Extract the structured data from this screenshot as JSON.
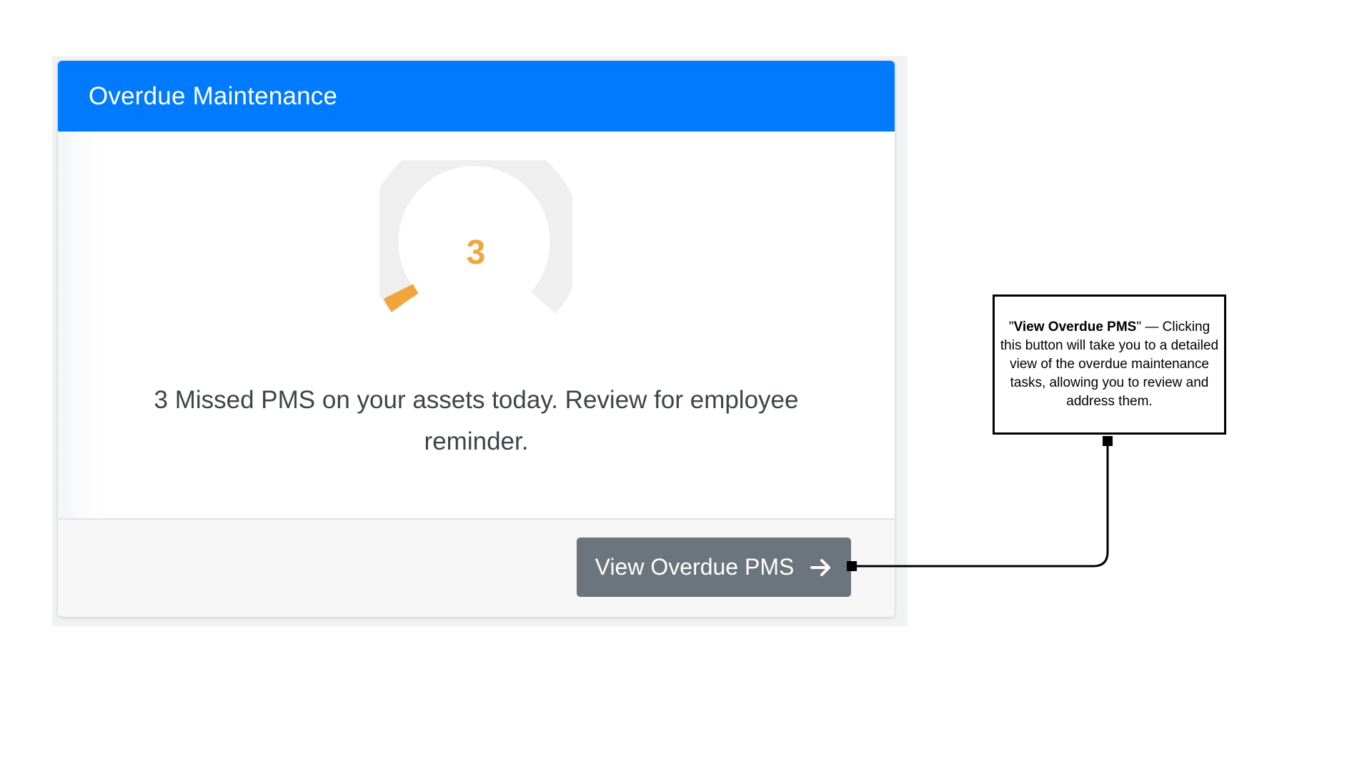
{
  "card": {
    "title": "Overdue Maintenance",
    "gauge": {
      "value": "3",
      "value_color": "#f0a63c",
      "track_color": "#efefef",
      "fill_color": "#f0a63c"
    },
    "message": "3 Missed PMS on your assets today. Review for employee reminder.",
    "button": {
      "label": "View Overdue PMS",
      "icon": "arrow-right-icon"
    },
    "header_color": "#007bff",
    "button_color": "#6c747d"
  },
  "callout": {
    "quote_open": "\"",
    "bold_text": "View Overdue PMS",
    "rest_text": "\" — Clicking this button will take you to a detailed view of the overdue maintenance tasks, allowing you to review and address them."
  }
}
